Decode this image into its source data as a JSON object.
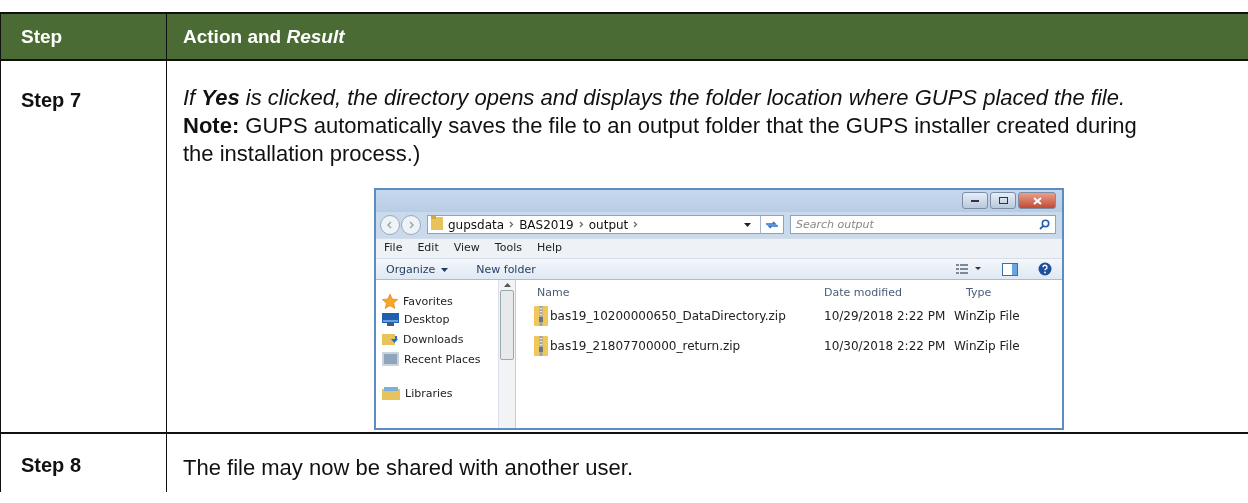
{
  "table": {
    "columns": [
      "Step",
      "Action and *Result*"
    ],
    "rows": [
      {
        "step": "Step 7",
        "paragraphs": [
          {
            "kind": "italic",
            "text": "If **Yes** is clicked, the directory opens and displays the folder location where GUPS placed the file."
          },
          {
            "kind": "plain",
            "text": "**Note:**  GUPS automatically saves the file to an output folder that the GUPS installer created during the installation process.)"
          }
        ],
        "screenshot": {
          "breadcrumbs": [
            "gupsdata",
            "BAS2019",
            "output"
          ],
          "search": {
            "placeholder": "Search output"
          },
          "menu": [
            "File",
            "Edit",
            "View",
            "Tools",
            "Help"
          ],
          "toolbar": [
            "Organize",
            "New folder"
          ],
          "nav_items": [
            {
              "kind": "favorites",
              "label": "Favorites"
            },
            {
              "kind": "desktop",
              "label": "Desktop"
            },
            {
              "kind": "downloads",
              "label": "Downloads"
            },
            {
              "kind": "recent",
              "label": "Recent Places"
            },
            {
              "kind": "libraries",
              "label": "Libraries"
            }
          ],
          "columns": [
            "Name",
            "Date modified",
            "Type"
          ],
          "files": [
            {
              "name": "bas19_10200000650_DataDirectory.zip",
              "date": "10/29/2018 2:22 PM",
              "type": "WinZip File"
            },
            {
              "name": "bas19_21807700000_return.zip",
              "date": "10/30/2018 2:22 PM",
              "type": "WinZip File"
            }
          ]
        }
      },
      {
        "step": "Step 8",
        "paragraphs": [
          {
            "kind": "plain",
            "text": "The file may now be shared with another user."
          }
        ]
      }
    ]
  }
}
